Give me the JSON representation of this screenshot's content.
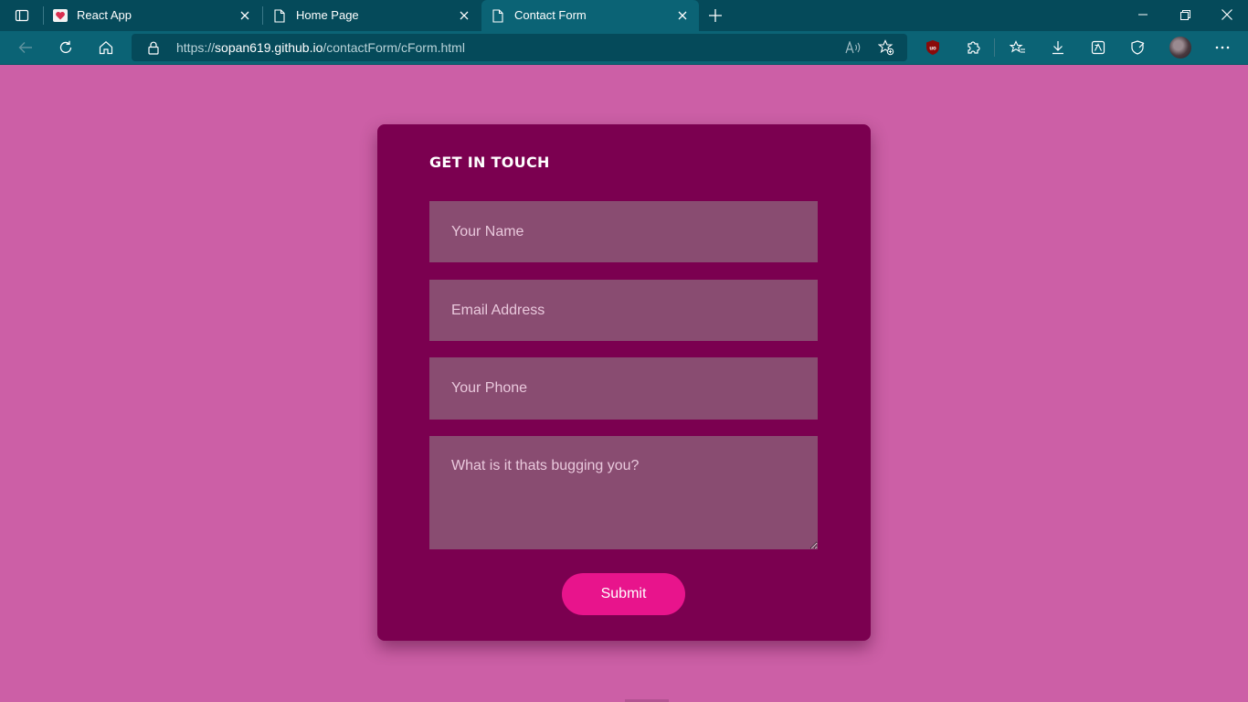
{
  "browser": {
    "tabs": [
      {
        "title": "React App",
        "favicon": "heart-favicon",
        "active": false
      },
      {
        "title": "Home Page",
        "favicon": "page-icon",
        "active": false
      },
      {
        "title": "Contact Form",
        "favicon": "page-icon",
        "active": true
      }
    ],
    "url_prefix": "https://",
    "url_host": "sopan619.github.io",
    "url_path": "/contactForm/cForm.html",
    "colors": {
      "tabbar": "#054a5a",
      "toolbar": "#0b6375",
      "address": "#054a5a"
    }
  },
  "page": {
    "background": "#cc5fa6",
    "card_color": "#7b0050",
    "title": "GET IN TOUCH",
    "name_placeholder": "Your Name",
    "email_placeholder": "Email Address",
    "phone_placeholder": "Your Phone",
    "message_placeholder": "What is it thats bugging you?",
    "submit_label": "Submit",
    "accent": "#e8148c"
  }
}
